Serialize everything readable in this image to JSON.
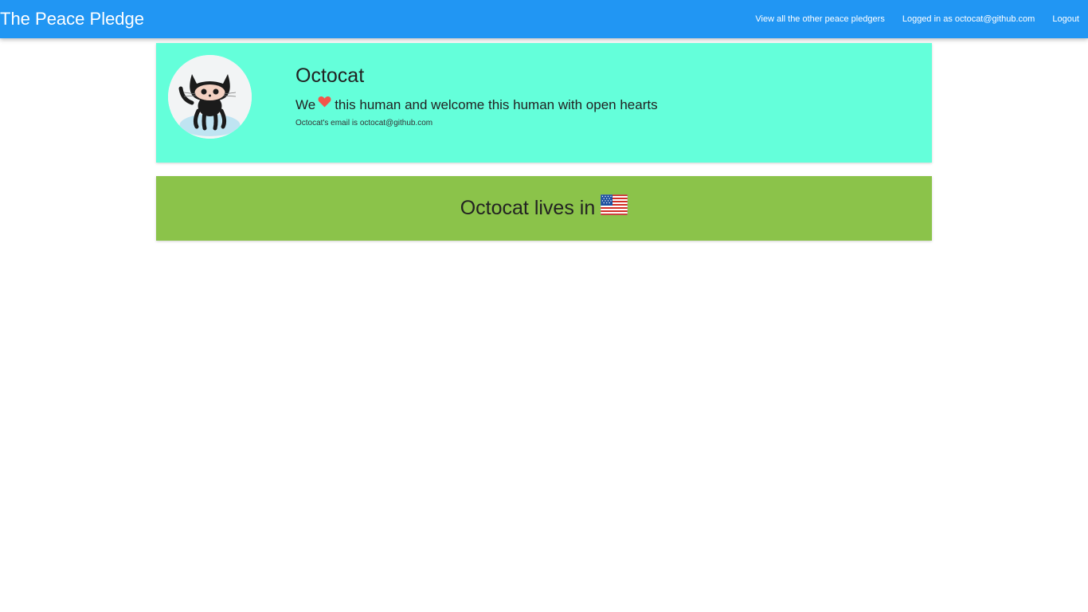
{
  "header": {
    "brand": "The Peace Pledge",
    "nav": {
      "view_all": "View all the other peace pledgers",
      "logged_in": "Logged in as octocat@github.com",
      "logout": "Logout"
    },
    "colors": {
      "bar": "#2196f3",
      "text": "#ffffff"
    }
  },
  "profile": {
    "avatar_icon": "octocat-avatar",
    "name": "Octocat",
    "welcome_prefix": "We",
    "heart_icon": "heart-icon",
    "welcome_suffix": "this human and welcome this human with open hearts",
    "email_line": "Octocat's email is octocat@github.com",
    "card_color": "#64ffda"
  },
  "country": {
    "text": "Octocat lives in",
    "flag_icon": "us-flag-icon",
    "card_color": "#8bc34a"
  }
}
